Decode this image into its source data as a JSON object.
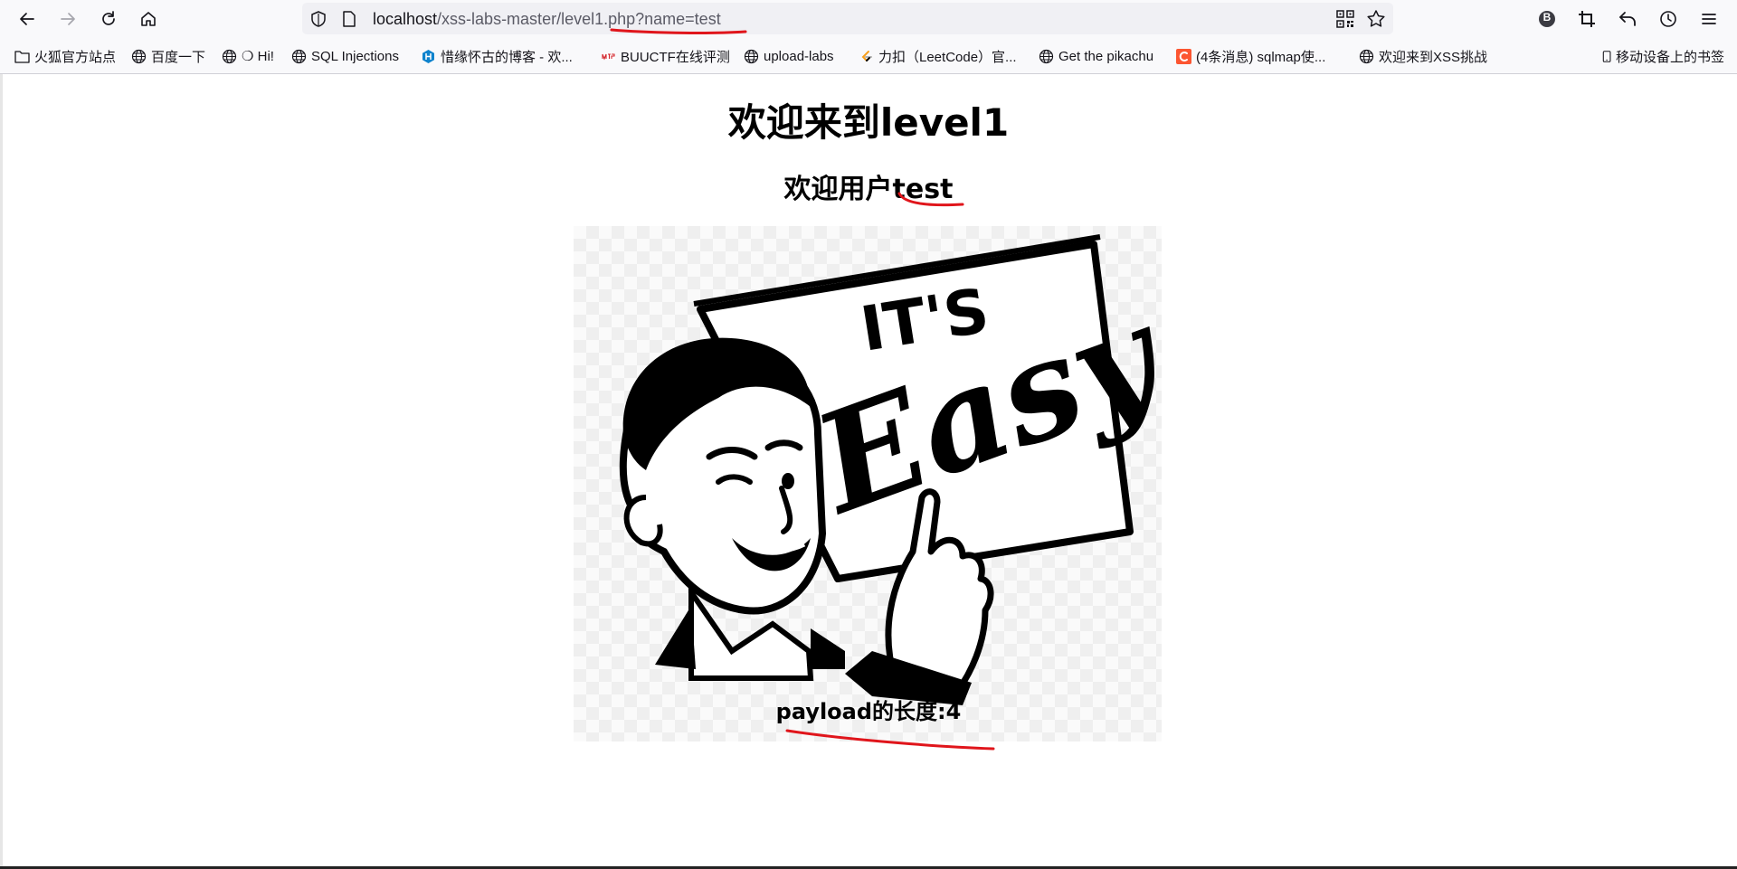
{
  "browser": {
    "url_host": "localhost",
    "url_path": "/xss-labs-master/level1.php?name=test",
    "profile_badge": "B"
  },
  "bookmarks": [
    {
      "label": "火狐官方站点",
      "icon": "folder-icon"
    },
    {
      "label": "百度一下",
      "icon": "globe-icon"
    },
    {
      "label": "❍ Hi!",
      "icon": "globe-icon"
    },
    {
      "label": "SQL Injections",
      "icon": "globe-icon"
    },
    {
      "label": "惜缘怀古的博客 - 欢...",
      "icon": "hexo-icon"
    },
    {
      "label": "BUUCTF在线评测",
      "icon": "buuctf-icon"
    },
    {
      "label": "upload-labs",
      "icon": "globe-icon"
    },
    {
      "label": "力扣（LeetCode）官...",
      "icon": "leetcode-icon"
    },
    {
      "label": "Get the pikachu",
      "icon": "globe-icon"
    },
    {
      "label": "(4条消息) sqlmap使...",
      "icon": "csdn-icon"
    },
    {
      "label": "欢迎来到XSS挑战",
      "icon": "globe-icon"
    }
  ],
  "mobile_bookmarks": "移动设备上的书签",
  "page": {
    "title": "欢迎来到level1",
    "welcome_prefix": "欢迎用户",
    "welcome_name": "test",
    "image_text_top": "IT'S",
    "image_text_main": "Easy",
    "payload_text": "payload的长度:4"
  },
  "colors": {
    "annotation": "#e0151b",
    "buuctf": "#d2232a",
    "hexo": "#0e83cd",
    "csdn": "#fc5531"
  }
}
